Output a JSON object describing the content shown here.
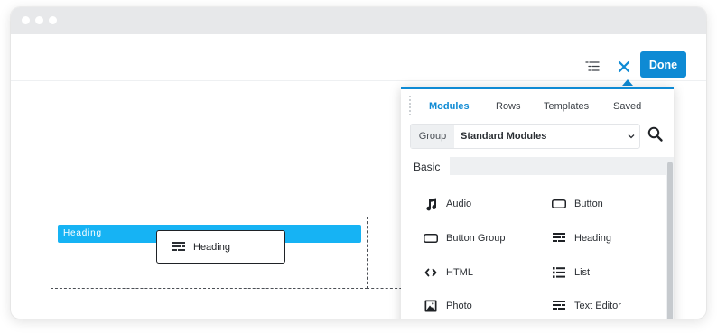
{
  "toolbar": {
    "done_label": "Done",
    "outline_icon": "outline-icon",
    "close_icon": "close-icon",
    "accent_color": "#0e8ad4"
  },
  "canvas": {
    "heading_bar_label": "Heading",
    "drag_chip_label": "Heading",
    "heading_bar_color": "#16b3f4"
  },
  "panel": {
    "tabs": [
      {
        "label": "Modules",
        "active": true
      },
      {
        "label": "Rows",
        "active": false
      },
      {
        "label": "Templates",
        "active": false
      },
      {
        "label": "Saved",
        "active": false
      }
    ],
    "group": {
      "label": "Group",
      "value": "Standard Modules"
    },
    "section": "Basic",
    "modules": [
      {
        "label": "Audio",
        "icon": "music-note-icon"
      },
      {
        "label": "Button",
        "icon": "button-icon"
      },
      {
        "label": "Button Group",
        "icon": "button-group-icon"
      },
      {
        "label": "Heading",
        "icon": "heading-icon"
      },
      {
        "label": "HTML",
        "icon": "code-icon"
      },
      {
        "label": "List",
        "icon": "list-icon"
      },
      {
        "label": "Photo",
        "icon": "photo-icon"
      },
      {
        "label": "Text Editor",
        "icon": "text-editor-icon"
      }
    ]
  }
}
